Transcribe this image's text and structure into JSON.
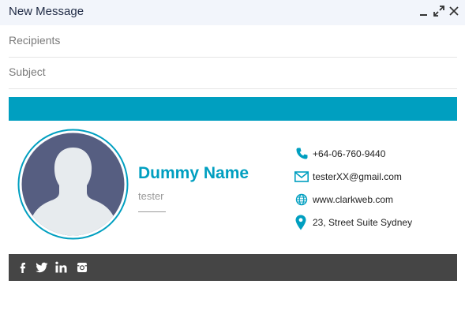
{
  "window": {
    "title": "New Message",
    "controls": [
      "minimize-icon",
      "expand-icon",
      "close-icon"
    ]
  },
  "compose": {
    "recipients_placeholder": "Recipients",
    "subject_placeholder": "Subject"
  },
  "signature": {
    "accent_color": "#009fc0",
    "name": "Dummy Name",
    "role": "tester",
    "avatar": "person-silhouette-icon",
    "contacts": [
      {
        "icon": "phone-icon",
        "text": "+64-06-760-9440"
      },
      {
        "icon": "email-icon",
        "text": "testerXX@gmail.com"
      },
      {
        "icon": "globe-icon",
        "text": "www.clarkweb.com"
      },
      {
        "icon": "location-pin-icon",
        "text": "23, Street Suite Sydney"
      }
    ],
    "footer_color": "#454545",
    "social": [
      "facebook-icon",
      "twitter-icon",
      "linkedin-icon",
      "instagram-icon"
    ]
  }
}
